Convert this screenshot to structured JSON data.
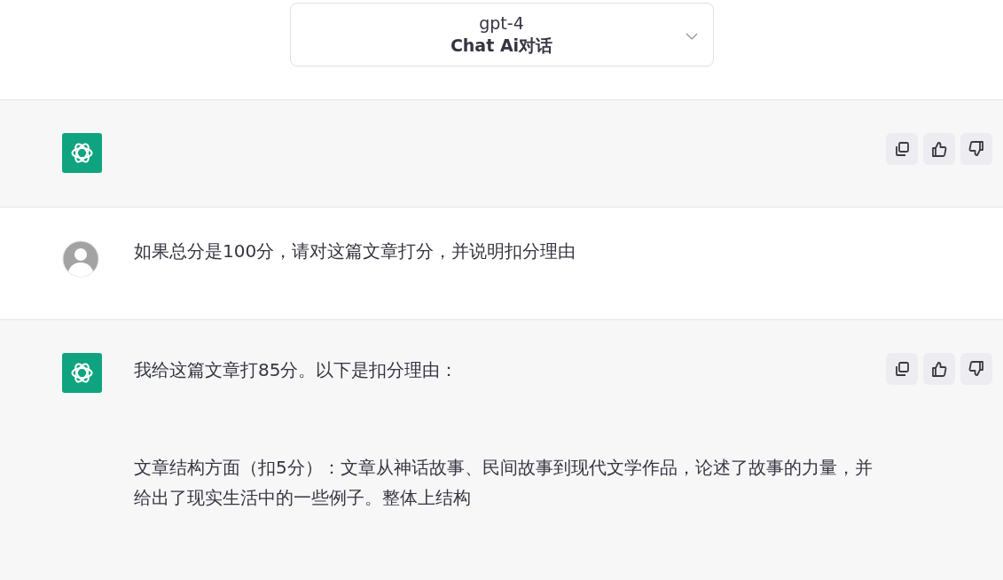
{
  "header": {
    "model": "gpt-4",
    "title": "Chat Ai对话"
  },
  "messages": [
    {
      "kind": "assistant"
    },
    {
      "kind": "user",
      "paragraphs": [
        "如果总分是100分，请对这篇文章打分，并说明扣分理由"
      ]
    },
    {
      "kind": "assistant",
      "paragraphs": [
        "我给这篇文章打85分。以下是扣分理由：",
        "文章结构方面（扣5分）：文章从神话故事、民间故事到现代文学作品，论述了故事的力量，并给出了现实生活中的一些例子。整体上结构"
      ]
    }
  ]
}
